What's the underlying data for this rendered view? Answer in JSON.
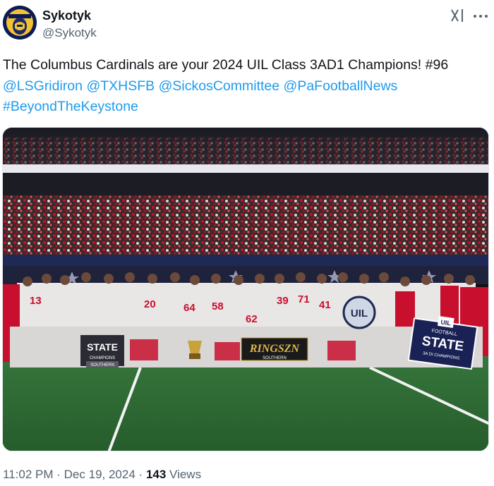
{
  "author": {
    "display_name": "Sykotyk",
    "handle": "@Sykotyk",
    "avatar_icon": "team-logo-avatar"
  },
  "header_icons": {
    "grok": "grok-icon",
    "more": "more-icon"
  },
  "tweet": {
    "text_prefix": "The Columbus Cardinals are your 2024 UIL Class 3AD1 Champions! #96",
    "mentions": [
      "@LSGridiron",
      "@TXHSFB",
      "@SickosCommittee",
      "@PaFootballNews"
    ],
    "hashtag": "#BeyondTheKeystone"
  },
  "media": {
    "banners": {
      "left_state": "STATE",
      "left_state_sub": "CHAMPIONS",
      "left_state_footer": "SOUTHERN",
      "ringszn": "RINGSZN",
      "ringszn_footer": "SOUTHERN",
      "right_state_top": "FOOTBALL",
      "right_state": "STATE",
      "right_state_sub": "3A DI CHAMPIONS",
      "uil_logo": "UIL",
      "uil_logo_2": "UIL"
    },
    "jersey_numbers": [
      "13",
      "20",
      "64",
      "58",
      "62",
      "41",
      "71",
      "39"
    ]
  },
  "meta": {
    "time": "11:02 PM",
    "separator": "·",
    "date": "Dec 19, 2024",
    "views_count": "143",
    "views_label": "Views"
  },
  "colors": {
    "link": "#1d9bf0",
    "muted": "#536471",
    "text": "#0f1419",
    "team_red": "#c8102e",
    "turf": "#2f6d36"
  }
}
